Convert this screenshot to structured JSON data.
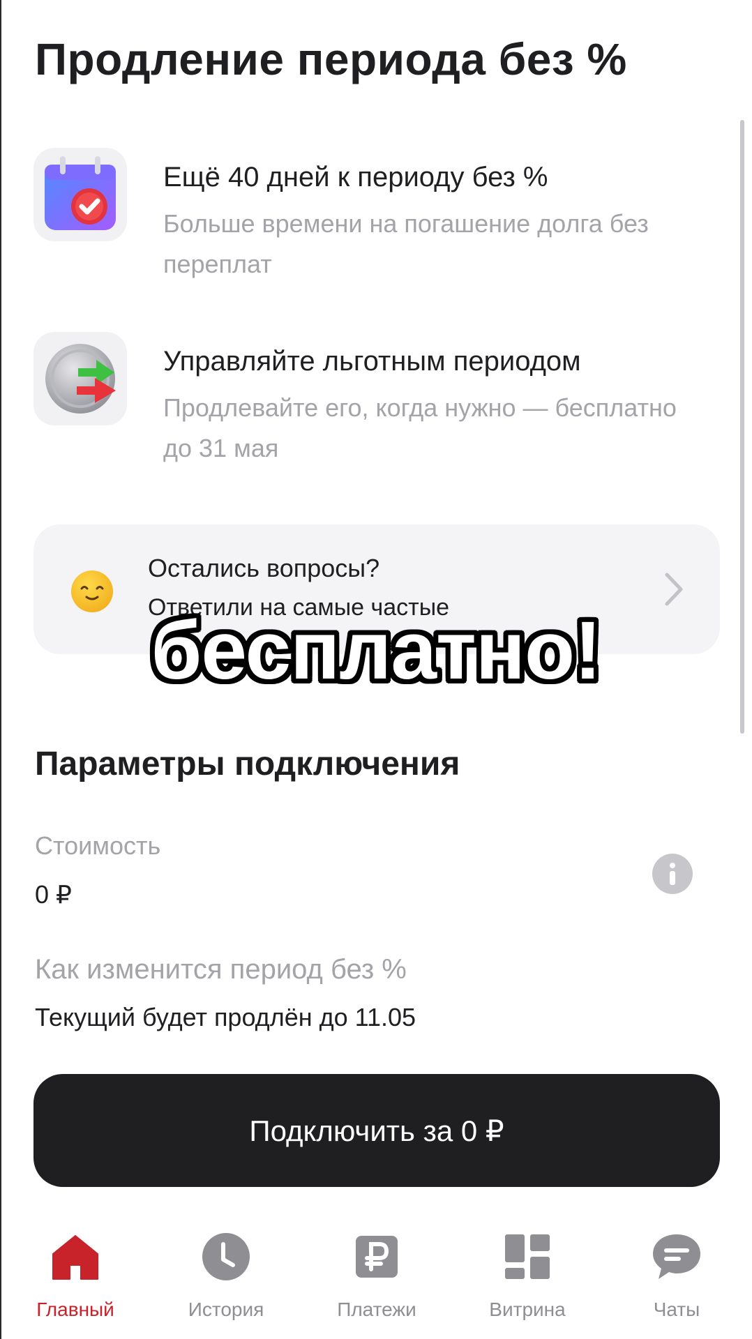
{
  "header": {
    "title": "Продление периода без %"
  },
  "features": [
    {
      "icon": "calendar-check-icon",
      "title": "Ещё 40 дней к периоду без %",
      "description": "Больше времени на погашение долга без переплат"
    },
    {
      "icon": "exchange-arrows-icon",
      "title": "Управляйте льготным периодом",
      "description": "Продлевайте его, когда нужно — бесплатно до 31 мая"
    }
  ],
  "faq": {
    "icon": "smile-emoji-icon",
    "title": "Остались вопросы?",
    "subtitle": "Ответили на самые частые"
  },
  "overlay_caption": "бесплатно!",
  "params": {
    "section_title": "Параметры подключения",
    "cost_label": "Стоимость",
    "cost_value": "0 ₽",
    "period_label": "Как изменится период без %",
    "period_value": "Текущий будет продлён до 11.05"
  },
  "cta": {
    "label": "Подключить за 0 ₽"
  },
  "tabbar": {
    "active_color": "#c8222b",
    "inactive_color": "#8e8e93",
    "tabs": [
      {
        "label": "Главный",
        "icon": "home-icon",
        "active": true
      },
      {
        "label": "История",
        "icon": "clock-icon",
        "active": false
      },
      {
        "label": "Платежи",
        "icon": "ruble-icon",
        "active": false
      },
      {
        "label": "Витрина",
        "icon": "grid-icon",
        "active": false
      },
      {
        "label": "Чаты",
        "icon": "chat-icon",
        "active": false
      }
    ]
  }
}
